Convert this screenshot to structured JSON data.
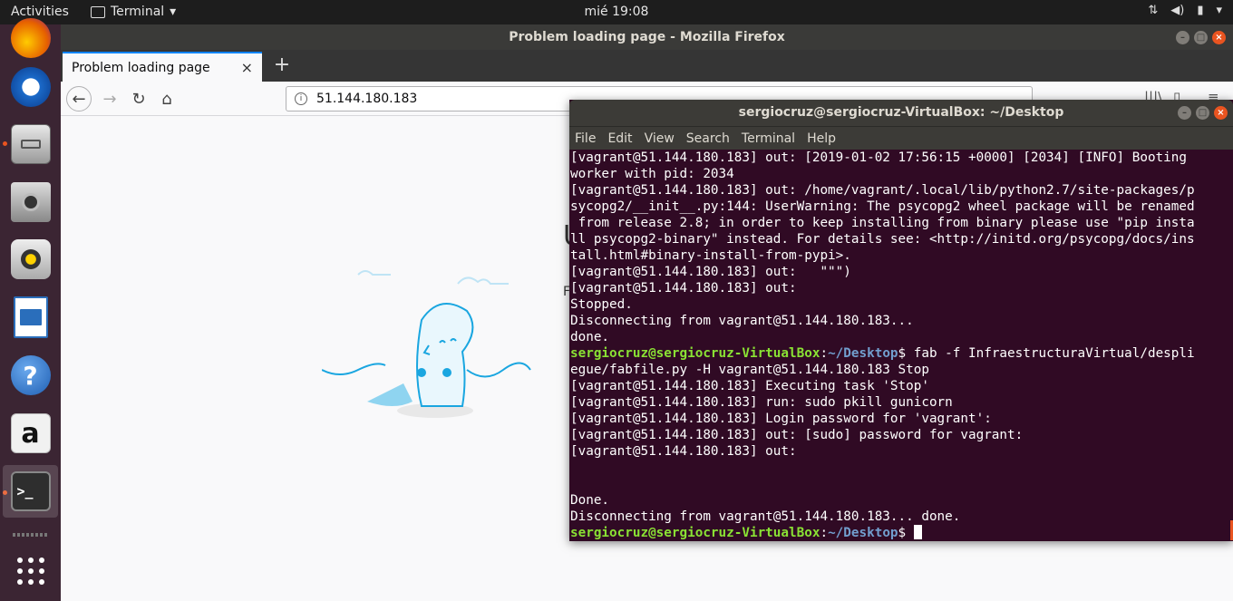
{
  "topbar": {
    "activities": "Activities",
    "app_name": "Terminal",
    "clock": "mié 19:08"
  },
  "dock": {
    "items": [
      {
        "name": "firefox",
        "icon": "firefox-icon"
      },
      {
        "name": "thunderbird",
        "icon": "thunderbird-icon"
      },
      {
        "name": "files",
        "icon": "files-icon"
      },
      {
        "name": "camera",
        "icon": "camera-icon"
      },
      {
        "name": "rhythmbox",
        "icon": "speaker-icon"
      },
      {
        "name": "writer",
        "icon": "writer-icon"
      },
      {
        "name": "help",
        "icon": "help-icon"
      },
      {
        "name": "amazon",
        "icon": "amazon-icon"
      },
      {
        "name": "terminal",
        "icon": "terminal-icon"
      },
      {
        "name": "app-grid",
        "icon": "grid-icon"
      }
    ],
    "help_glyph": "?",
    "amazon_glyph": "a",
    "terminal_glyph": ">_"
  },
  "firefox": {
    "window_title": "Problem loading page - Mozilla Firefox",
    "tab_label": "Problem loading page",
    "url": "51.144.180.183",
    "content_fragment_1": "U",
    "content_fragment_2": "F"
  },
  "terminal": {
    "window_title": "sergiocruz@sergiocruz-VirtualBox: ~/Desktop",
    "menu": [
      "File",
      "Edit",
      "View",
      "Search",
      "Terminal",
      "Help"
    ],
    "prompt_user": "sergiocruz@sergiocruz-VirtualBox",
    "prompt_path": "~/Desktop",
    "lines": [
      {
        "type": "out",
        "text": "[vagrant@51.144.180.183] out: [2019-01-02 17:56:15 +0000] [2034] [INFO] Booting"
      },
      {
        "type": "out",
        "text": "worker with pid: 2034"
      },
      {
        "type": "out",
        "text": "[vagrant@51.144.180.183] out: /home/vagrant/.local/lib/python2.7/site-packages/p"
      },
      {
        "type": "out",
        "text": "sycopg2/__init__.py:144: UserWarning: The psycopg2 wheel package will be renamed"
      },
      {
        "type": "out",
        "text": " from release 2.8; in order to keep installing from binary please use \"pip insta"
      },
      {
        "type": "out",
        "text": "ll psycopg2-binary\" instead. For details see: <http://initd.org/psycopg/docs/ins"
      },
      {
        "type": "out",
        "text": "tall.html#binary-install-from-pypi>."
      },
      {
        "type": "out",
        "text": "[vagrant@51.144.180.183] out:   \"\"\")"
      },
      {
        "type": "out",
        "text": "[vagrant@51.144.180.183] out:"
      },
      {
        "type": "out",
        "text": "Stopped."
      },
      {
        "type": "out",
        "text": "Disconnecting from vagrant@51.144.180.183..."
      },
      {
        "type": "out",
        "text": "done."
      },
      {
        "type": "prompt",
        "text": " fab -f InfraestructuraVirtual/despli"
      },
      {
        "type": "out",
        "text": "egue/fabfile.py -H vagrant@51.144.180.183 Stop"
      },
      {
        "type": "out",
        "text": "[vagrant@51.144.180.183] Executing task 'Stop'"
      },
      {
        "type": "out",
        "text": "[vagrant@51.144.180.183] run: sudo pkill gunicorn"
      },
      {
        "type": "out",
        "text": "[vagrant@51.144.180.183] Login password for 'vagrant':"
      },
      {
        "type": "out",
        "text": "[vagrant@51.144.180.183] out: [sudo] password for vagrant:"
      },
      {
        "type": "out",
        "text": "[vagrant@51.144.180.183] out:"
      },
      {
        "type": "out",
        "text": ""
      },
      {
        "type": "out",
        "text": ""
      },
      {
        "type": "out",
        "text": "Done."
      },
      {
        "type": "out",
        "text": "Disconnecting from vagrant@51.144.180.183... done."
      },
      {
        "type": "prompt",
        "text": " ",
        "cursor": true
      }
    ]
  },
  "colors": {
    "terminal_bg": "#300a24",
    "prompt_user": "#8ae234",
    "prompt_path": "#729fcf",
    "accent": "#e95420",
    "firefox_tab_accent": "#0a84ff"
  }
}
